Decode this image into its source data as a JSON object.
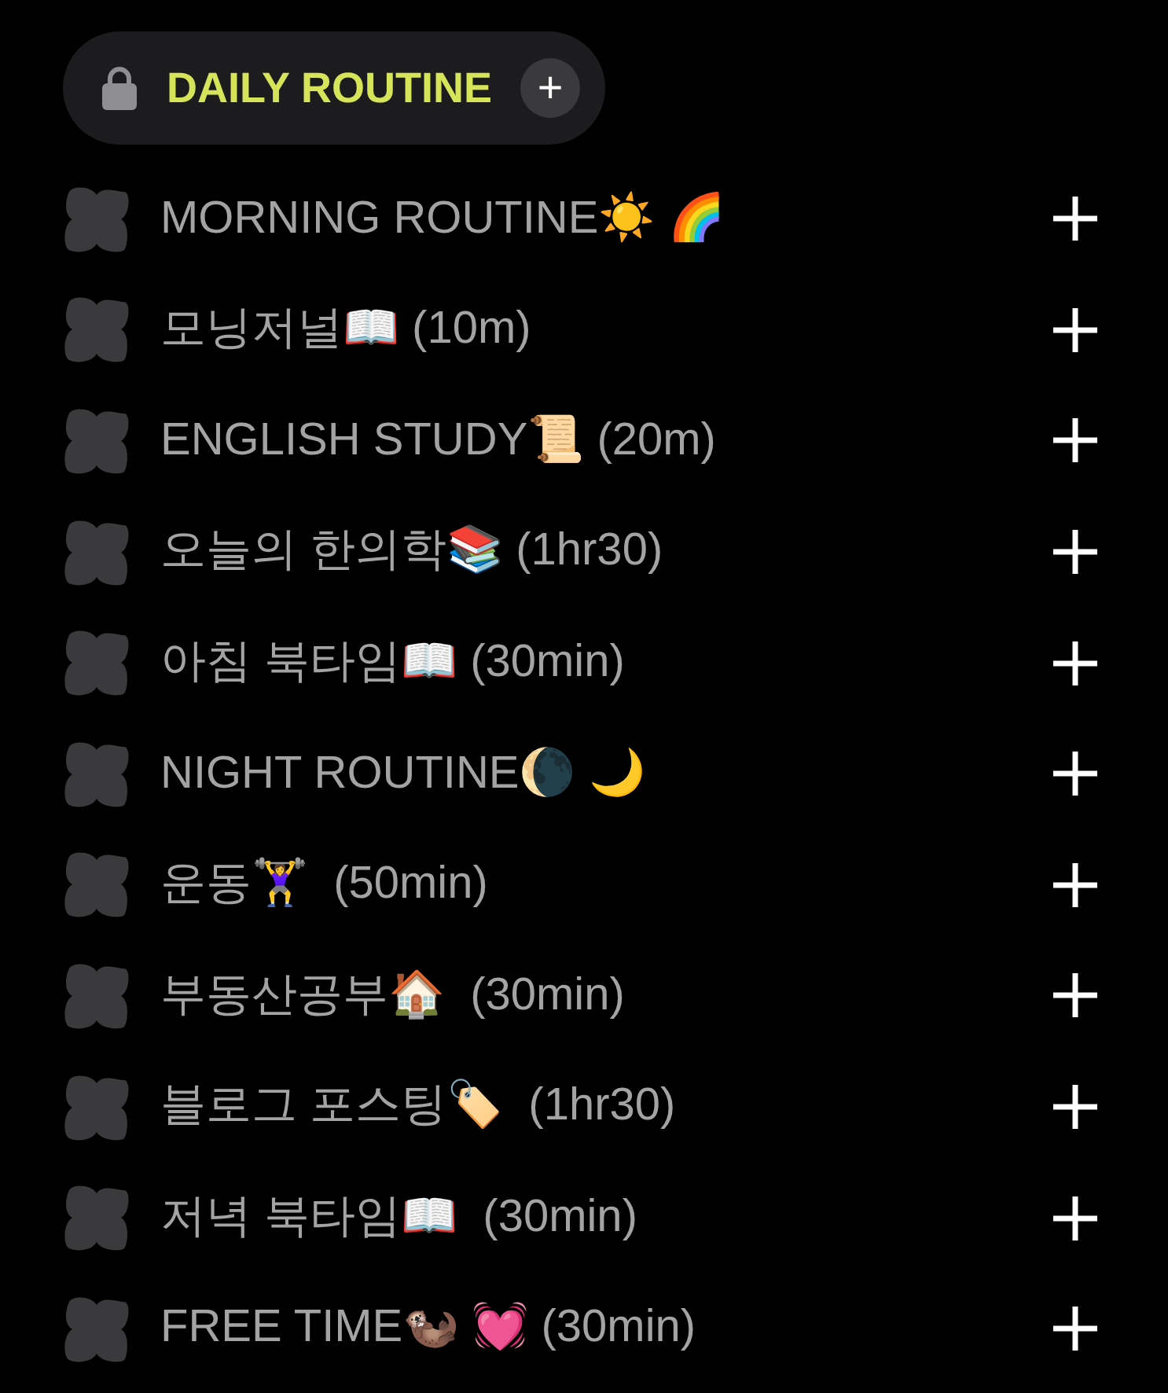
{
  "header": {
    "title": "DAILY ROUTINE",
    "add": "+"
  },
  "items": [
    {
      "label": "MORNING ROUTINE☀️ 🌈"
    },
    {
      "label": "모닝저널📖 (10m)"
    },
    {
      "label": "ENGLISH STUDY📜 (20m)"
    },
    {
      "label": "오늘의 한의학📚 (1hr30)"
    },
    {
      "label": "아침 북타임📖 (30min)"
    },
    {
      "label": "NIGHT ROUTINE🌘 🌙"
    },
    {
      "label": "운동🏋️‍♀️  (50min)"
    },
    {
      "label": "부동산공부🏠  (30min)"
    },
    {
      "label": "블로그 포스팅🏷️  (1hr30)"
    },
    {
      "label": "저녁 북타임📖  (30min)"
    },
    {
      "label": "FREE TIME🦦 💓 (30min)"
    }
  ]
}
